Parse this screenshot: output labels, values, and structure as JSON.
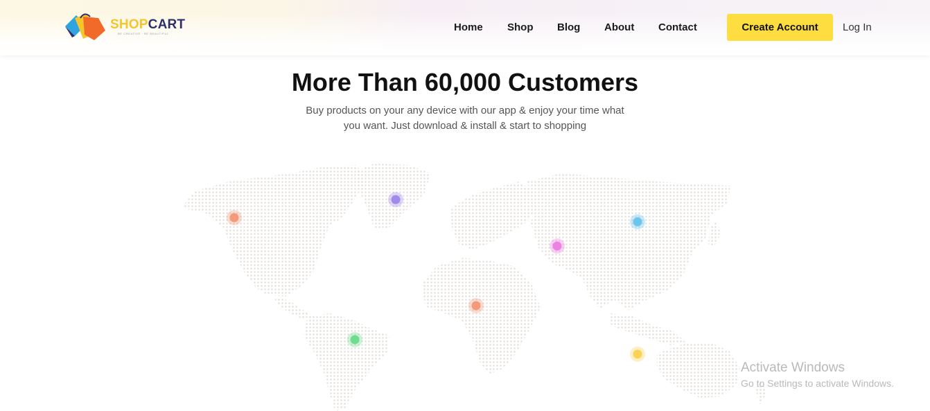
{
  "brand": {
    "name_part1": "SHOP",
    "name_part2": "CART",
    "tagline": "BE CREATIVE · BE BEAUTIFUL",
    "colors": {
      "yellow": "#f6c52b",
      "navy": "#2d2f6b",
      "blue": "#2fa5e0",
      "orange": "#f26a2a"
    }
  },
  "nav": {
    "items": [
      {
        "label": "Home"
      },
      {
        "label": "Shop"
      },
      {
        "label": "Blog"
      },
      {
        "label": "About"
      },
      {
        "label": "Contact"
      }
    ],
    "create_account": "Create Account",
    "login": "Log In"
  },
  "hero": {
    "title": "More Than 60,000 Customers",
    "subtitle_line1": "Buy products on your any device with our app & enjoy your time what",
    "subtitle_line2": "you want. Just download & install & start to shopping"
  },
  "map": {
    "land_color": "#eeeae6",
    "markers": [
      {
        "id": "north-america",
        "color": "#f39a7a"
      },
      {
        "id": "greenland",
        "color": "#a08ce8"
      },
      {
        "id": "south-america",
        "color": "#6fdc90"
      },
      {
        "id": "africa",
        "color": "#f39a7a"
      },
      {
        "id": "middle-east",
        "color": "#ee82e2"
      },
      {
        "id": "russia",
        "color": "#6cc6ef"
      },
      {
        "id": "indonesia",
        "color": "#fad257"
      }
    ]
  },
  "watermark": {
    "title": "Activate Windows",
    "subtitle": "Go to Settings to activate Windows."
  }
}
